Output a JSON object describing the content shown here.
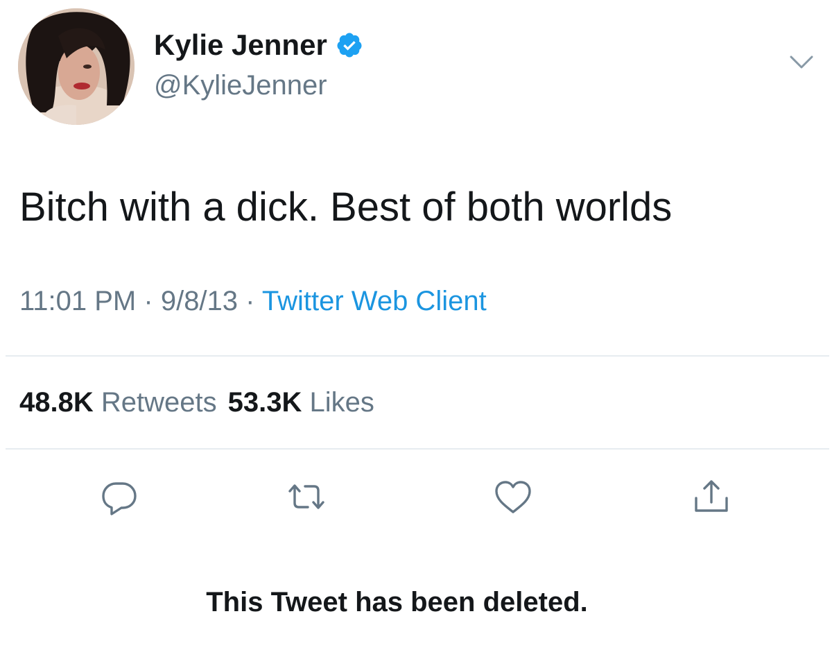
{
  "author": {
    "display_name": "Kylie Jenner",
    "handle": "@KylieJenner",
    "verified": true
  },
  "tweet": {
    "text": "Bitch with a dick. Best of both worlds",
    "time": "11:01 PM",
    "date": "9/8/13",
    "separator": "·",
    "source": "Twitter Web Client"
  },
  "stats": {
    "retweets_count": "48.8K",
    "retweets_label": "Retweets",
    "likes_count": "53.3K",
    "likes_label": "Likes"
  },
  "actions": [
    "reply-icon",
    "retweet-icon",
    "like-icon",
    "share-icon"
  ],
  "notice": "This Tweet has been deleted.",
  "colors": {
    "text": "#14171a",
    "secondary": "#657786",
    "link": "#1b95e0",
    "verified": "#1da1f2",
    "divider": "#e6ecf0"
  }
}
